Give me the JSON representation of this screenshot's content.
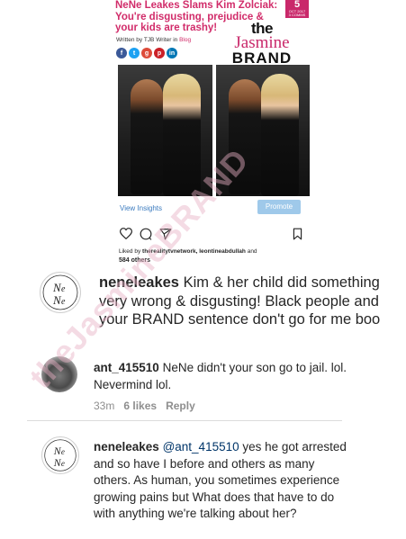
{
  "article": {
    "headline": "NeNe Leakes Slams Kim Zolciak: You're disgusting, prejudice & your kids are trashy!",
    "byline_prefix": "Written by TJB Writer in",
    "byline_category": "Blog",
    "date_day": "5",
    "date_month": "OCT 2017",
    "date_comments": "3 COMMS",
    "brand_the": "the",
    "brand_jasmine": "Jasmine",
    "brand_brand": "BRAND",
    "social_icons": [
      "facebook-icon",
      "twitter-icon",
      "google-plus-icon",
      "pinterest-icon",
      "linkedin-icon"
    ]
  },
  "post": {
    "view_insights": "View Insights",
    "promote": "Promote",
    "liked_by_prefix": "Liked by",
    "liked_by_users": "therealitytvnetwork, leontineabdullah",
    "liked_by_suffix": "and",
    "likes_count": "584 others"
  },
  "comments": [
    {
      "username": "neneleakes",
      "text": "Kim & her child did something very wrong & disgusting! Black people and your BRAND sentence don't go for me boo"
    },
    {
      "username": "ant_415510",
      "text": "NeNe didn't your son go to jail. lol. Nevermind lol.",
      "time": "33m",
      "likes": "6 likes",
      "reply": "Reply"
    },
    {
      "username": "neneleakes",
      "mention": "@ant_415510",
      "text": "yes he got arrested and so have I before and others as many others. As human, you sometimes experience growing pains but What does that have to do with anything we're talking about her?"
    }
  ],
  "watermark": "theJasmineBRAND",
  "colors": {
    "brand_pink": "#d12c6a",
    "link_blue": "#3b7bbf",
    "promote_blue": "#9fc9ea",
    "muted": "#8e8e8e"
  }
}
